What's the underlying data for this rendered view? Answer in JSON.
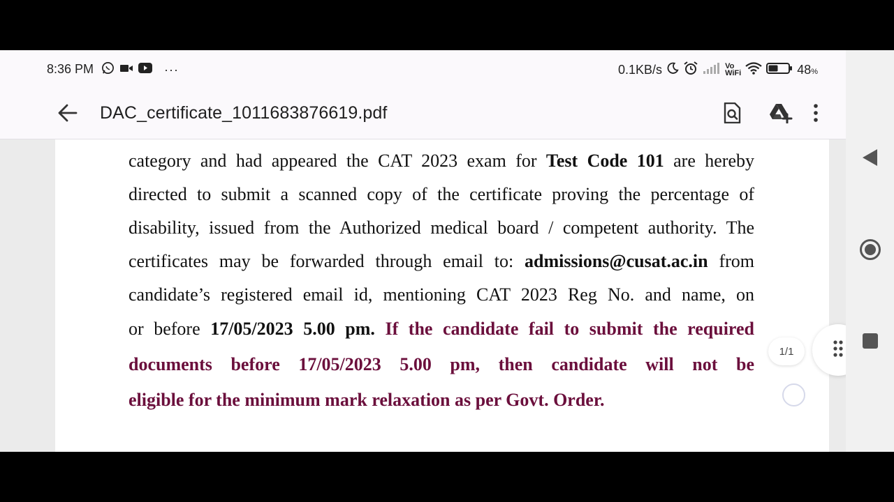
{
  "status_bar": {
    "time": "8:36 PM",
    "left_icons": [
      "whatsapp-icon",
      "video-camera-icon",
      "youtube-icon",
      "more-notifications-icon"
    ],
    "more_dots": "···",
    "network_speed": "0.1KB/s",
    "vowifi_top": "Vo",
    "vowifi_bottom": "WiFi",
    "battery_level": "48",
    "battery_unit": "%",
    "battery_fraction": 0.48
  },
  "app_bar": {
    "file_name": "DAC_certificate_1011683876619.pdf",
    "actions": [
      "search-document-icon",
      "add-to-drive-icon",
      "overflow-menu-icon"
    ]
  },
  "document": {
    "line1": {
      "a": "category and had appeared the CAT 2023 exam for ",
      "b": "Test Code 101",
      "c": " are hereby"
    },
    "line2": "directed to submit a scanned copy of the certificate proving the percentage of",
    "line3": "disability, issued from the Authorized medical board / competent authority. The",
    "line4": {
      "a": "certificates may be forwarded through email to: ",
      "b": "admissions@cusat.ac.in",
      "c": " from"
    },
    "line5": "candidate’s registered email id, mentioning  CAT 2023 Reg No. and name, on",
    "line6": {
      "a": "or before ",
      "b": "17/05/2023 5.00 pm.",
      "c": " If the candidate fail to submit the required"
    },
    "line7": "documents before 17/05/2023 5.00 pm, then candidate will not be",
    "line8": "eligible for the minimum mark relaxation as per Govt. Order.",
    "warning_color": "#6b0f3c"
  },
  "page_indicator": "1/1",
  "colors": {
    "background": "#ebebeb",
    "app_bar": "#fbf9fc",
    "edit_fab": "#dee0fb"
  }
}
